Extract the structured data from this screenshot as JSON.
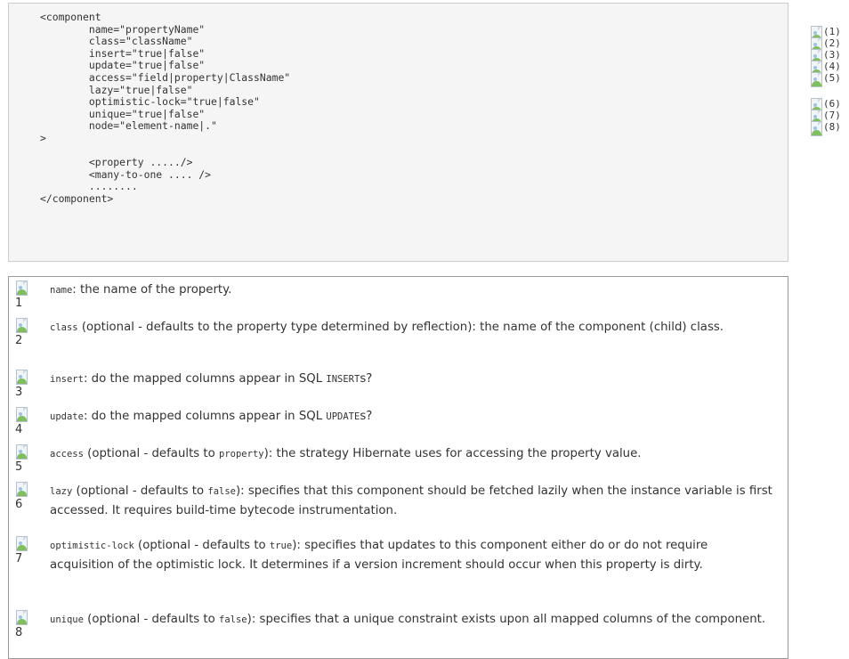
{
  "code": {
    "lines": [
      "<component",
      "        name=\"propertyName\"",
      "        class=\"className\"",
      "        insert=\"true|false\"",
      "        update=\"true|false\"",
      "        access=\"field|property|ClassName\"",
      "        lazy=\"true|false\"",
      "        optimistic-lock=\"true|false\"",
      "        unique=\"true|false\"",
      "        node=\"element-name|.\"",
      ">",
      "",
      "        <property ...../>",
      "        <many-to-one .... />",
      "        ........",
      "</component>"
    ]
  },
  "callout_markers": [
    "(1)",
    "(2)",
    "(3)",
    "(4)",
    "(5)",
    "(6)",
    "(7)",
    "(8)"
  ],
  "callouts": [
    {
      "number": "1",
      "segments": [
        {
          "code": "name"
        },
        {
          "text": ": the name of the property."
        }
      ]
    },
    {
      "number": "2",
      "segments": [
        {
          "code": "class"
        },
        {
          "text": " (optional - defaults to the property type determined by reflection): the name of the component (child) class."
        }
      ]
    },
    {
      "number": "3",
      "segments": [
        {
          "code": "insert"
        },
        {
          "text": ": do the mapped columns appear in SQL "
        },
        {
          "code": "INSERT"
        },
        {
          "text": "s?"
        }
      ]
    },
    {
      "number": "4",
      "segments": [
        {
          "code": "update"
        },
        {
          "text": ": do the mapped columns appear in SQL "
        },
        {
          "code": "UPDATE"
        },
        {
          "text": "s?"
        }
      ]
    },
    {
      "number": "5",
      "segments": [
        {
          "code": "access"
        },
        {
          "text": " (optional - defaults to "
        },
        {
          "code": "property"
        },
        {
          "text": "): the strategy Hibernate uses for accessing the property value."
        }
      ]
    },
    {
      "number": "6",
      "segments": [
        {
          "code": "lazy"
        },
        {
          "text": " (optional - defaults to "
        },
        {
          "code": "false"
        },
        {
          "text": "): specifies that this component should be fetched lazily when the instance variable is first accessed. It requires build-time bytecode instrumentation."
        }
      ]
    },
    {
      "number": "7",
      "segments": [
        {
          "code": "optimistic-lock"
        },
        {
          "text": " (optional - defaults to "
        },
        {
          "code": "true"
        },
        {
          "text": "): specifies that updates to this component either do or do not require acquisition of the optimistic lock. It determines if a version increment should occur when this property is dirty."
        }
      ]
    },
    {
      "number": "8",
      "segments": [
        {
          "code": "unique"
        },
        {
          "text": " (optional - defaults to "
        },
        {
          "code": "false"
        },
        {
          "text": "): specifies that a unique constraint exists upon all mapped columns of the component."
        }
      ]
    }
  ]
}
